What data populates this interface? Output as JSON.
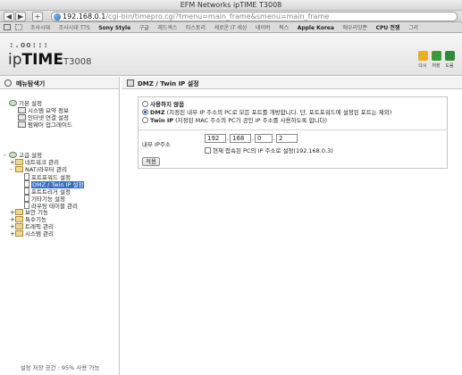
{
  "window": {
    "title": "EFM Networks ipTIME T3008"
  },
  "toolbar": {
    "back": "◀",
    "forward": "▶",
    "add": "+",
    "url_host": "192.168.0.1",
    "url_path": "/cgi-bin/timepro.cgi?tmenu=main_frame&smenu=main_frame"
  },
  "bookmarks": {
    "items": [
      "조사시대",
      "조사시대 TTS",
      "Sony Style",
      "구글",
      "레드섹스",
      "티스토리",
      "세로운 IT 세상",
      "네이버",
      "퍽스",
      "Apple Korea",
      "애우리앗뿐",
      "CPU 전쟁",
      "그리"
    ]
  },
  "router": {
    "dots": ":.oo:::",
    "brand_light": "ip",
    "brand_bold": "TIME",
    "model": "T3008",
    "buttons": [
      {
        "label": "다시",
        "color": "#e8b020"
      },
      {
        "label": "저장",
        "color": "#3a9a3a"
      },
      {
        "label": "도움",
        "color": "#2f8a3c"
      }
    ]
  },
  "menu": {
    "title": "메뉴탐색기",
    "basic": "기본 설정",
    "system_summary": "시스템 요약 정보",
    "internet_setup": "인터넷 연결 설정",
    "firmware": "펌웨어 업그레이드",
    "advanced": "고급 설정",
    "network": "네트워크 관리",
    "nat": "NAT/라우터 관리",
    "port_forward": "포트포워드 설정",
    "dmz": "DMZ / Twin IP 설정",
    "port_trigger": "포트트리거 설정",
    "misc": "기타기능 설정",
    "routing": "라우팅 테이블 관리",
    "security": "보안 기능",
    "special": "특수기능",
    "traffic": "트래픽 관리",
    "system_mgmt": "시스템 관리",
    "footer": "설정 저장 공간 : 95% 사용 가능"
  },
  "content": {
    "title": "DMZ / Twin IP 설정",
    "options": [
      {
        "bold": "사용하지 않음",
        "desc": "",
        "selected": false
      },
      {
        "bold": "DMZ",
        "desc": " (지정된 내부 IP 주소의 PC로 모든 포트를 개방합니다. 단, 포트포워드에 설정된 포트는 제외)",
        "selected": true
      },
      {
        "bold": "Twin IP",
        "desc": " (지정된 MAC 주소의 PC가 공인 IP 주소를 사용하도록 합니다)",
        "selected": false
      }
    ],
    "ip_label": "내부 IP주소",
    "ip": [
      "192",
      "168",
      "0",
      "2"
    ],
    "current_pc_label": "현재 접속된 PC의 IP 주소로 설정(192.168.0.3)",
    "apply": "적용"
  }
}
